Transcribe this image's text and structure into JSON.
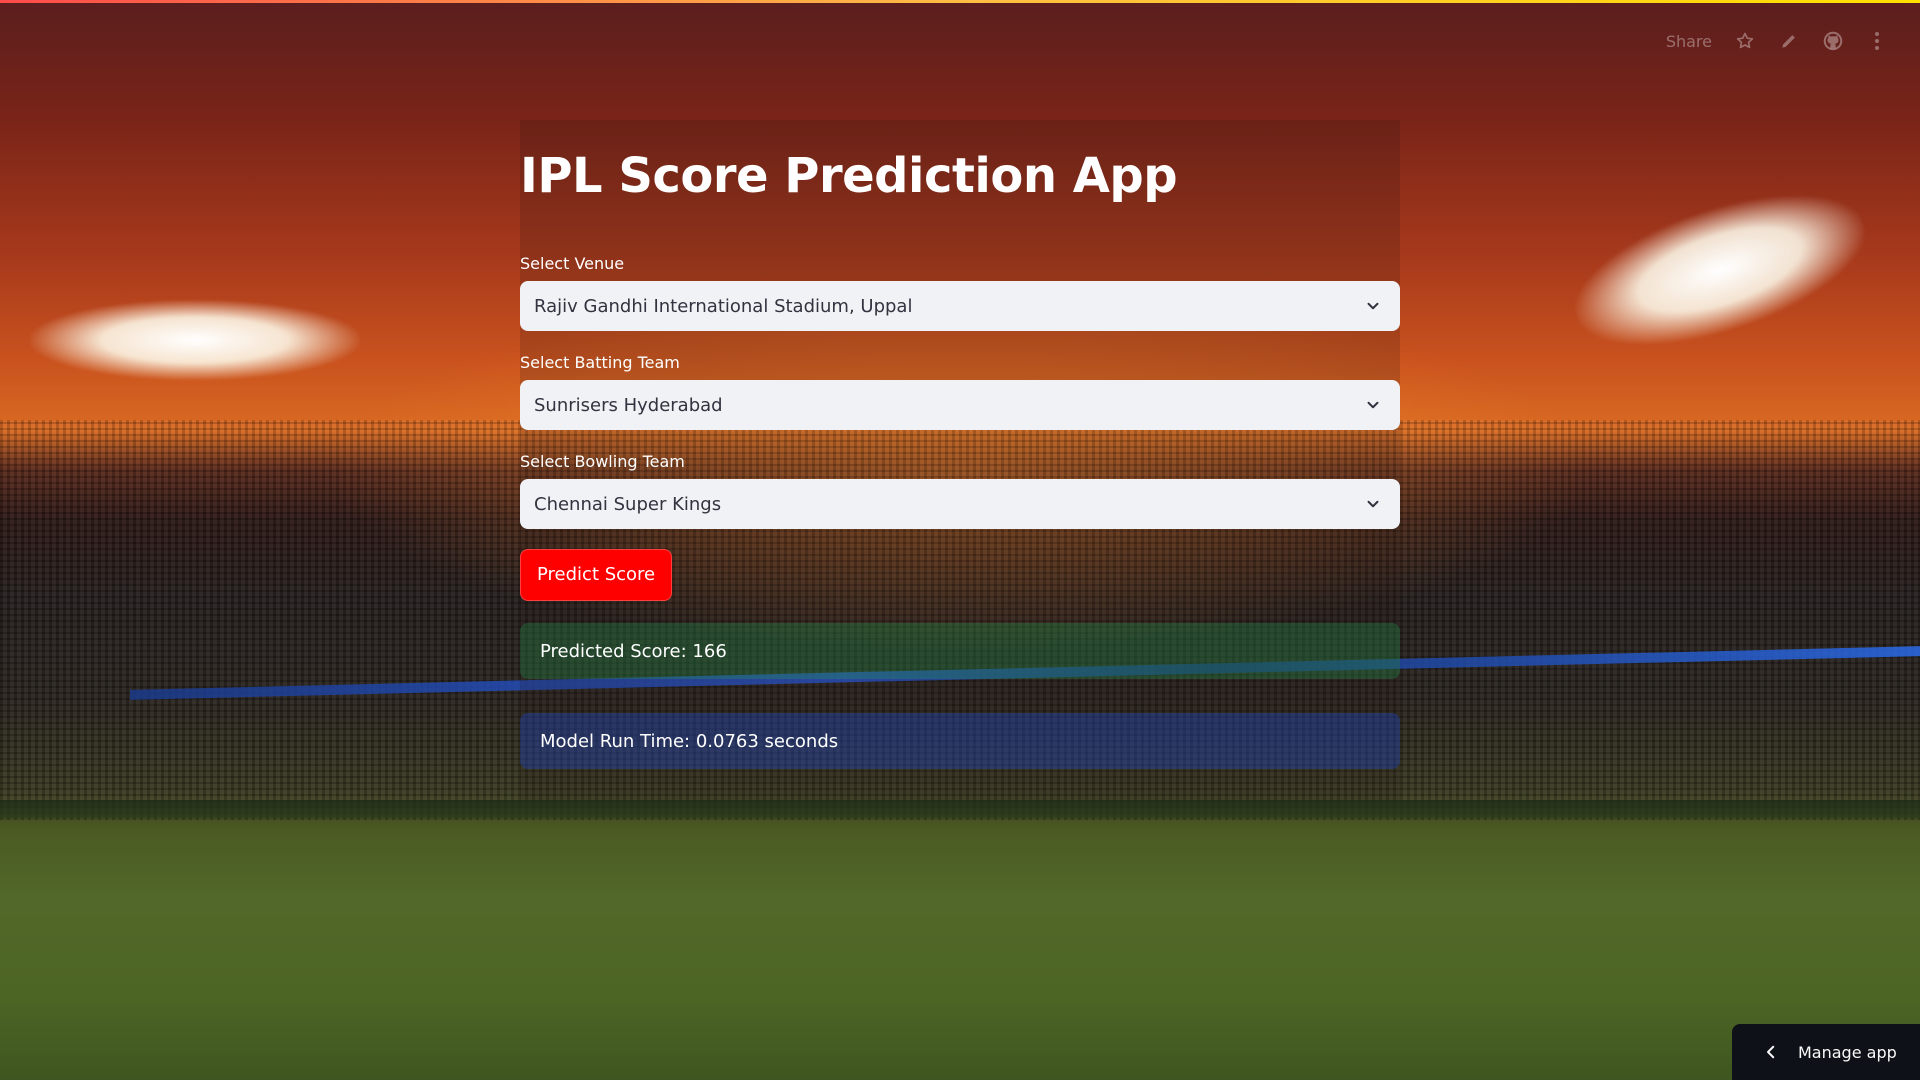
{
  "toolbar": {
    "share_label": "Share",
    "icons": [
      "star-icon",
      "edit-icon",
      "github-icon",
      "more-icon"
    ]
  },
  "main": {
    "title": "IPL Score Prediction App",
    "venue": {
      "label": "Select Venue",
      "value": "Rajiv Gandhi International Stadium, Uppal"
    },
    "batting_team": {
      "label": "Select Batting Team",
      "value": "Sunrisers Hyderabad"
    },
    "bowling_team": {
      "label": "Select Bowling Team",
      "value": "Chennai Super Kings"
    },
    "predict_button": "Predict Score",
    "result": "Predicted Score: 166",
    "runtime": "Model Run Time: 0.0763 seconds"
  },
  "footer": {
    "manage_app": "Manage app"
  },
  "colors": {
    "accent": "#ff0000",
    "select_bg": "#f0f2f6",
    "success_bg": "#21a050",
    "info_bg": "#1c46c8",
    "manage_bg": "#0e1117"
  }
}
